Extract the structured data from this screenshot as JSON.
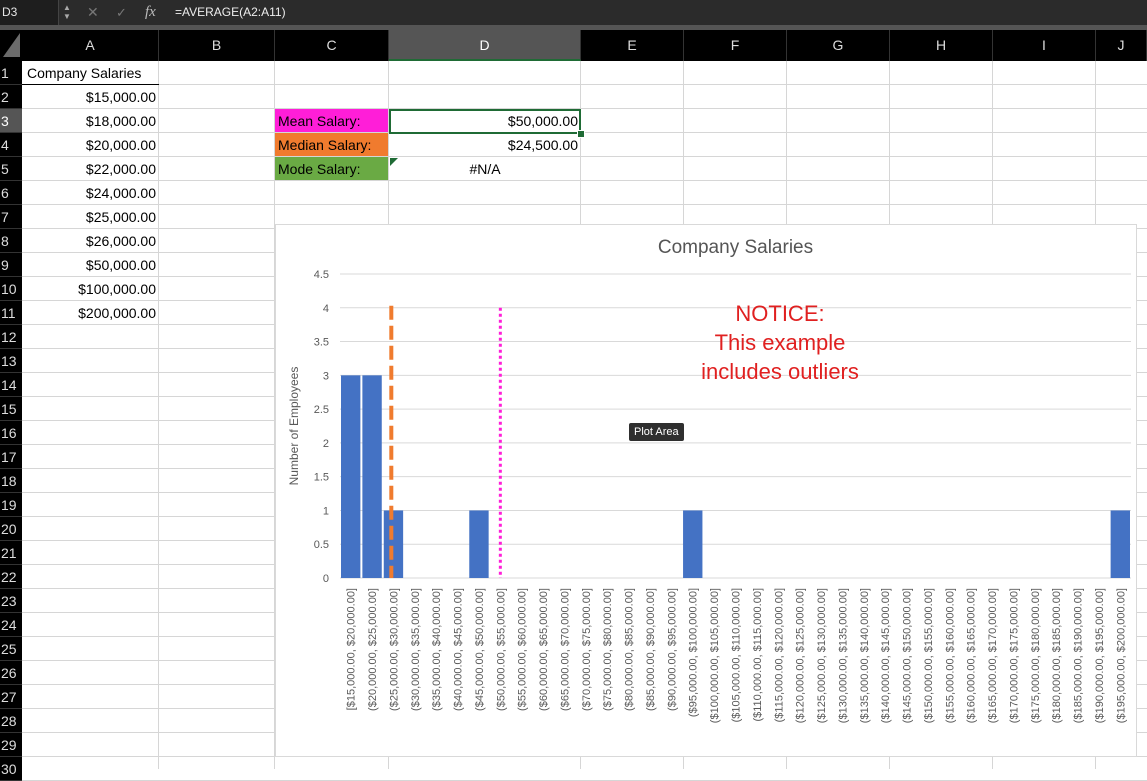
{
  "formula_bar": {
    "cell_ref": "D3",
    "fx_label": "fx",
    "formula": "=AVERAGE(A2:A11)",
    "cancel_glyph": "✕",
    "confirm_glyph": "✓"
  },
  "columns": [
    "A",
    "B",
    "C",
    "D",
    "E",
    "F",
    "G",
    "H",
    "I",
    "J"
  ],
  "rows": [
    "1",
    "2",
    "3",
    "4",
    "5",
    "6",
    "7",
    "8",
    "9",
    "10",
    "11",
    "12",
    "13",
    "14",
    "15",
    "16",
    "17",
    "18",
    "19",
    "20",
    "21",
    "22",
    "23",
    "24",
    "25",
    "26",
    "27",
    "28",
    "29",
    "30"
  ],
  "selected_cell": {
    "column": "D",
    "row": "3"
  },
  "sheet": {
    "header": "Company Salaries",
    "salaries": [
      "$15,000.00",
      "$18,000.00",
      "$20,000.00",
      "$22,000.00",
      "$24,000.00",
      "$25,000.00",
      "$26,000.00",
      "$50,000.00",
      "$100,000.00",
      "$200,000.00"
    ],
    "stats": [
      {
        "label": "Mean Salary:",
        "value": "$50,000.00",
        "color": "#ff1ed8"
      },
      {
        "label": "Median Salary:",
        "value": "$24,500.00",
        "color": "#f07b2e"
      },
      {
        "label": "Mode Salary:",
        "value": "#N/A",
        "color": "#6aaa44"
      }
    ]
  },
  "chart_data": {
    "type": "bar",
    "title": "Company Salaries",
    "xlabel": "",
    "ylabel": "Number of Employees",
    "ylim": [
      0,
      4.5
    ],
    "yticks": [
      "0",
      "0.5",
      "1",
      "1.5",
      "2",
      "2.5",
      "3",
      "3.5",
      "4",
      "4.5"
    ],
    "categories": [
      "[$15,000.00, $20,000.00]",
      "($20,000.00, $25,000.00]",
      "($25,000.00, $30,000.00]",
      "($30,000.00, $35,000.00]",
      "($35,000.00, $40,000.00]",
      "($40,000.00, $45,000.00]",
      "($45,000.00, $50,000.00]",
      "($50,000.00, $55,000.00]",
      "($55,000.00, $60,000.00]",
      "($60,000.00, $65,000.00]",
      "($65,000.00, $70,000.00]",
      "($70,000.00, $75,000.00]",
      "($75,000.00, $80,000.00]",
      "($80,000.00, $85,000.00]",
      "($85,000.00, $90,000.00]",
      "($90,000.00, $95,000.00]",
      "($95,000.00, $100,000.00]",
      "($100,000.00, $105,000.00]",
      "($105,000.00, $110,000.00]",
      "($110,000.00, $115,000.00]",
      "($115,000.00, $120,000.00]",
      "($120,000.00, $125,000.00]",
      "($125,000.00, $130,000.00]",
      "($130,000.00, $135,000.00]",
      "($135,000.00, $140,000.00]",
      "($140,000.00, $145,000.00]",
      "($145,000.00, $150,000.00]",
      "($150,000.00, $155,000.00]",
      "($155,000.00, $160,000.00]",
      "($160,000.00, $165,000.00]",
      "($165,000.00, $170,000.00]",
      "($170,000.00, $175,000.00]",
      "($175,000.00, $180,000.00]",
      "($180,000.00, $185,000.00]",
      "($185,000.00, $190,000.00]",
      "($190,000.00, $195,000.00]",
      "($195,000.00, $200,000.00]"
    ],
    "values": [
      3,
      3,
      1,
      0,
      0,
      0,
      1,
      0,
      0,
      0,
      0,
      0,
      0,
      0,
      0,
      0,
      1,
      0,
      0,
      0,
      0,
      0,
      0,
      0,
      0,
      0,
      0,
      0,
      0,
      0,
      0,
      0,
      0,
      0,
      0,
      0,
      1
    ],
    "bar_color": "#4472c4",
    "grid": true,
    "reference_lines": [
      {
        "name": "median",
        "x": 24500,
        "style": "dashed",
        "color": "#f07b2e"
      },
      {
        "name": "mean",
        "x": 50000,
        "style": "dotted",
        "color": "#ff1ed8"
      }
    ],
    "annotation": {
      "lines": [
        "NOTICE:",
        "This example",
        "includes outliers"
      ],
      "color": "#e02020"
    },
    "tooltip": "Plot Area"
  }
}
